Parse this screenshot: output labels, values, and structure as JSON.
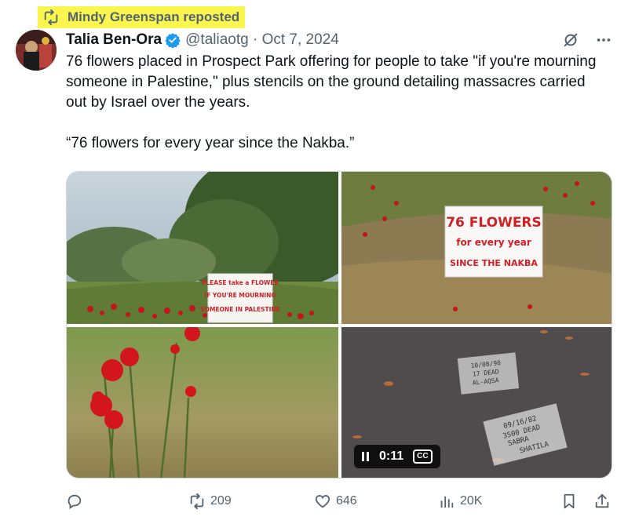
{
  "repost": {
    "label": "Mindy Greenspan reposted",
    "highlight_color": "#fbf64d"
  },
  "author": {
    "display_name": "Talia Ben-Ora",
    "handle": "@taliaotg",
    "separator": "·",
    "date": "Oct 7, 2024",
    "verified": true,
    "verified_color": "#1d9bf0"
  },
  "tweet": {
    "paragraph1": "76 flowers placed in Prospect Park offering for people to take \"if you're mourning someone in Palestine,\" plus stencils on the ground detailing massacres carried out by Israel over the years.",
    "paragraph2": "“76 flowers for every year since the Nakba.”"
  },
  "media": {
    "sign1": [
      "PLEASE take a FLOWER",
      "IF YOU'RE MOURNING",
      "SOMEONE IN PALESTINE"
    ],
    "sign2": [
      "76 FLOWERS",
      "for every year",
      "SINCE THE NAKBA"
    ],
    "stencil1": [
      "10/08/90",
      "17 DEAD",
      "AL-AQSA"
    ],
    "stencil2": [
      "09/16/82",
      "3500 DEAD",
      "SABRA",
      "SHATILA"
    ],
    "video": {
      "time": "0:11",
      "cc_label": "CC"
    }
  },
  "actions": {
    "replies": "",
    "reposts": "209",
    "likes": "646",
    "views": "20K"
  },
  "icons": {
    "repost": "repost-icon",
    "verified": "verified-badge-icon",
    "grok": "grok-icon",
    "more": "more-icon",
    "reply": "reply-icon",
    "like": "heart-icon",
    "views": "views-icon",
    "bookmark": "bookmark-icon",
    "share": "share-icon",
    "pause": "pause-icon"
  }
}
